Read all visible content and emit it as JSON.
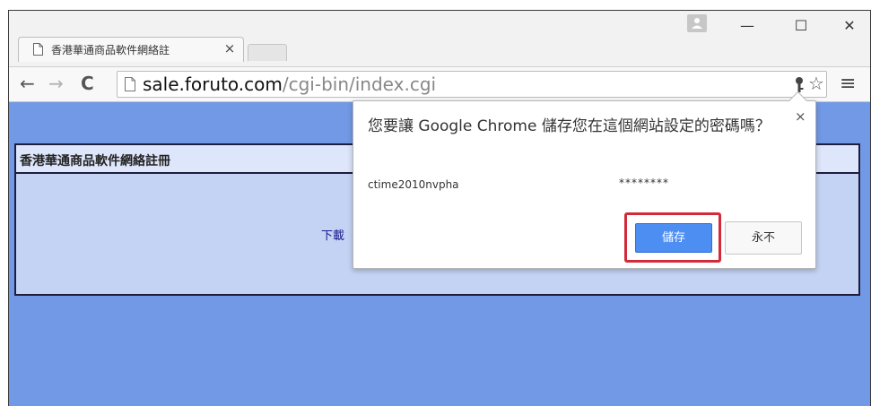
{
  "browser": {
    "tab": {
      "title": "香港華通商品軟件網絡註",
      "close_glyph": "×"
    },
    "window_controls": {
      "minimize": "—",
      "maximize": "☐",
      "close": "✕"
    },
    "toolbar": {
      "back_glyph": "←",
      "forward_glyph": "→",
      "reload_glyph": "C",
      "url_host": "sale.foruto.com",
      "url_path": "/cgi-bin/index.cgi",
      "star_glyph": "☆",
      "menu_glyph": "≡"
    }
  },
  "page": {
    "panel_title": "香港華通商品軟件網絡註冊",
    "download_text": "下載"
  },
  "password_bubble": {
    "title": "您要讓 Google Chrome 儲存您在這個網站設定的密碼嗎？",
    "close_glyph": "×",
    "username": "ctime2010nvpha",
    "password_masked": "********",
    "save_label": "儲存",
    "never_label": "永不"
  },
  "colors": {
    "page_background": "#7299e6",
    "panel_background": "#c4d3f4",
    "save_button": "#4d8ef2",
    "highlight_ring": "#d32a3a"
  },
  "icons": {
    "tab": "page-icon",
    "profile": "person-icon",
    "address_bar": [
      "page-icon",
      "key-icon",
      "star-icon"
    ],
    "menu": "hamburger-menu-icon"
  }
}
